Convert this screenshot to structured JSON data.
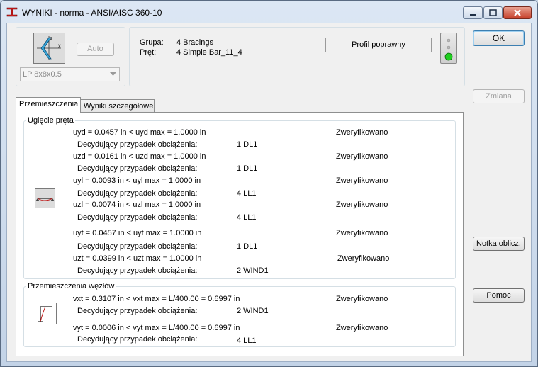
{
  "window": {
    "title": "WYNIKI - norma - ANSI/AISC 360-10"
  },
  "section": {
    "auto_label": "Auto",
    "profile": "LP 8x8x0.5",
    "group_label": "Grupa:",
    "group_value": "4  Bracings",
    "bar_label": "Pręt:",
    "bar_value": "4  Simple Bar_11_4",
    "status": "Profil poprawny"
  },
  "buttons": {
    "ok": "OK",
    "change": "Zmiana",
    "calc_note": "Notka oblicz.",
    "help": "Pomoc"
  },
  "tabs": [
    {
      "label": "Przemieszczenia"
    },
    {
      "label": "Wyniki szczegółowe"
    }
  ],
  "deflection": {
    "title": "Ugięcie pręta",
    "rows": [
      {
        "formula": "uyd = 0.0457 in  <  uyd max = 1.0000 in",
        "status": "Zweryfikowano",
        "case_label": "Decydujący przypadek obciążenia:",
        "case": "1 DL1"
      },
      {
        "formula": "uzd = 0.0161 in  <  uzd max = 1.0000 in",
        "status": "Zweryfikowano",
        "case_label": "Decydujący przypadek obciążenia:",
        "case": "1 DL1"
      },
      {
        "formula": "uyl = 0.0093 in  <  uyl max = 1.0000 in",
        "status": "Zweryfikowano",
        "case_label": "Decydujący przypadek obciążenia:",
        "case": "4 LL1"
      },
      {
        "formula": "uzl = 0.0074 in  <  uzl max = 1.0000 in",
        "status": "Zweryfikowano",
        "case_label": "Decydujący przypadek obciążenia:",
        "case": "4 LL1"
      },
      {
        "formula": "uyt = 0.0457 in  <  uyt max = 1.0000 in",
        "status": "Zweryfikowano",
        "case_label": "Decydujący przypadek obciążenia:",
        "case": "1 DL1"
      },
      {
        "formula": "uzt = 0.0399 in  <  uzt max = 1.0000 in",
        "status": "Zweryfikowano",
        "case_label": "Decydujący przypadek obciążenia:",
        "case": "2 WIND1"
      }
    ]
  },
  "node_disp": {
    "title": "Przemieszczenia węzłów",
    "rows": [
      {
        "formula": "vxt = 0.3107 in  <  vxt max = L/400.00 = 0.6997 in",
        "status": "Zweryfikowano",
        "case_label": "Decydujący przypadek obciążenia:",
        "case": "2 WIND1"
      },
      {
        "formula": "vyt = 0.0006 in  <  vyt max = L/400.00 = 0.6997 in",
        "status": "Zweryfikowano",
        "case_label": "Decydujący przypadek obciążenia:",
        "case": "4 LL1"
      }
    ]
  },
  "icons": {
    "app": "steel-beam-icon",
    "section": "angle-section-icon",
    "beam": "beam-deflection-icon",
    "frame": "frame-displacement-icon",
    "traffic": "traffic-light-icon",
    "dropdown": "chevron-down-icon"
  }
}
